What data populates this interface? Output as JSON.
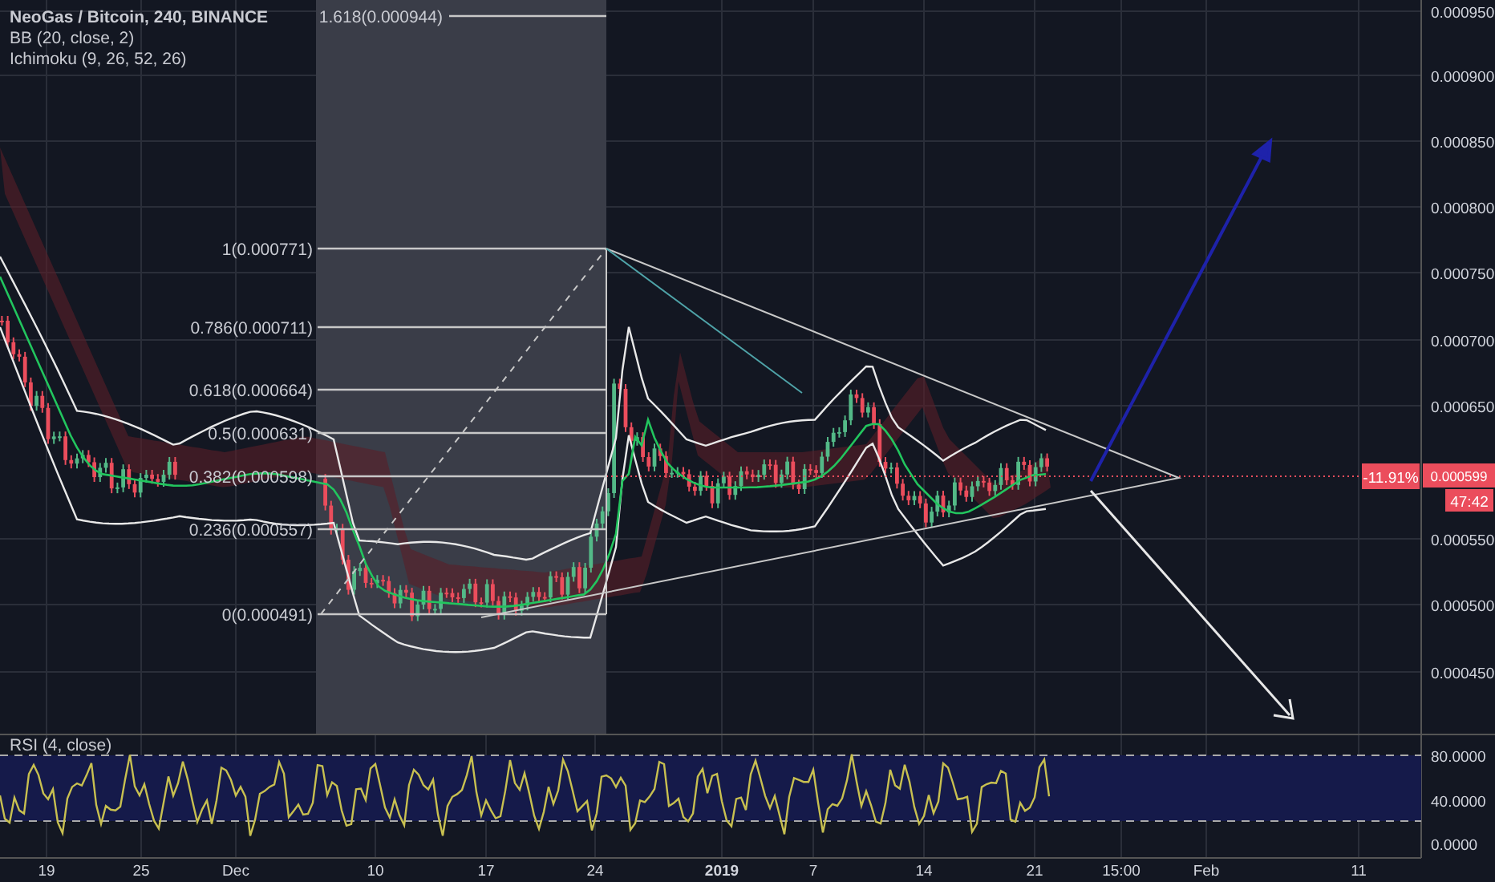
{
  "legend": [
    "NeoGas / Bitcoin, 240, BINANCE",
    "BB (20, close, 2)",
    "Ichimoku (9, 26, 52, 26)"
  ],
  "fib_levels": [
    "1.618(0.000944)",
    "1(0.000771)",
    "0.786(0.000711)",
    "0.618(0.000664)",
    "0.5(0.000631)",
    "0.382(0.000598)",
    "0.236(0.000557)",
    "0(0.000491)"
  ],
  "price_axis": [
    "0.000950",
    "0.000900",
    "0.000850",
    "0.000800",
    "0.000750",
    "0.000700",
    "0.000650",
    "0.000550",
    "0.000500",
    "0.000450"
  ],
  "last_price": {
    "value": "0.000599",
    "change": "-11.91%",
    "countdown": "47:42"
  },
  "rsi": {
    "label": "RSI (4, close)",
    "axis": [
      "80.0000",
      "40.0000",
      "0.0000"
    ]
  },
  "time_axis": [
    {
      "text": "19",
      "kind": "day"
    },
    {
      "text": "25",
      "kind": "day"
    },
    {
      "text": "Dec",
      "kind": "month"
    },
    {
      "text": "10",
      "kind": "day"
    },
    {
      "text": "17",
      "kind": "day"
    },
    {
      "text": "24",
      "kind": "day"
    },
    {
      "text": "2019",
      "kind": "year"
    },
    {
      "text": "7",
      "kind": "day"
    },
    {
      "text": "14",
      "kind": "day"
    },
    {
      "text": "21",
      "kind": "day"
    },
    {
      "text": "15:00",
      "kind": "time"
    },
    {
      "text": "Feb",
      "kind": "month"
    },
    {
      "text": "11",
      "kind": "day"
    }
  ]
}
